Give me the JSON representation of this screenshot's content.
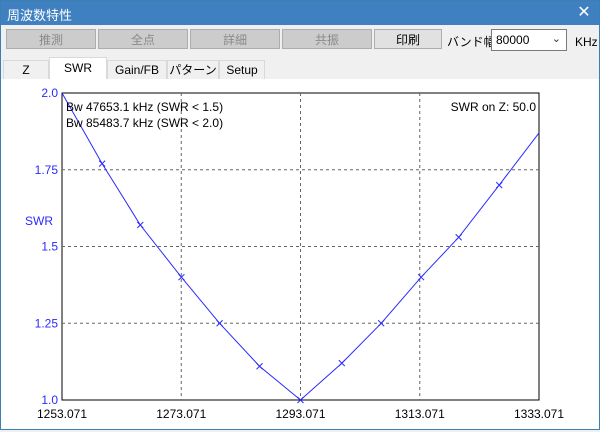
{
  "window": {
    "title": "周波数特性",
    "close_glyph": "✕"
  },
  "toolbar": {
    "buttons": [
      "推測",
      "全点",
      "詳細",
      "共振",
      "印刷"
    ],
    "band_label": "バンド幅",
    "band_value": "80000",
    "band_unit": "KHz"
  },
  "tabs": [
    "Z",
    "SWR",
    "Gain/FB",
    "パターン",
    "Setup"
  ],
  "selected_tab": "SWR",
  "chart_data": {
    "type": "line",
    "ylabel": "SWR",
    "xlabel": "",
    "ylim": [
      1.0,
      2.0
    ],
    "xlim": [
      1253.071,
      1333.071
    ],
    "x_ticks": [
      "1253.071",
      "1273.071",
      "1293.071",
      "1313.071",
      "1333.071"
    ],
    "y_ticks": [
      "2.0",
      "1.75",
      "1.5",
      "1.25",
      "1.0"
    ],
    "x_tick_values": [
      1253.071,
      1273.071,
      1293.071,
      1313.071,
      1333.071
    ],
    "y_tick_values": [
      2.0,
      1.75,
      1.5,
      1.25,
      1.0
    ],
    "series": [
      {
        "x": [
          1253.071,
          1259.8,
          1266.2,
          1273.1,
          1279.5,
          1286.2,
          1293.071,
          1300.0,
          1306.6,
          1313.3,
          1319.6,
          1326.4,
          1333.071
        ],
        "values": [
          2.0,
          1.77,
          1.57,
          1.4,
          1.25,
          1.11,
          1.0,
          1.12,
          1.25,
          1.4,
          1.53,
          1.7,
          1.87
        ]
      }
    ],
    "annotations": [
      "Bw 47653.1 kHz (SWR < 1.5)",
      "Bw 85483.7 kHz (SWR < 2.0)",
      "SWR on Z: 50.0"
    ],
    "grid": true,
    "line_color": "#2a2aff",
    "axis_label_color": "#2a2aff"
  }
}
